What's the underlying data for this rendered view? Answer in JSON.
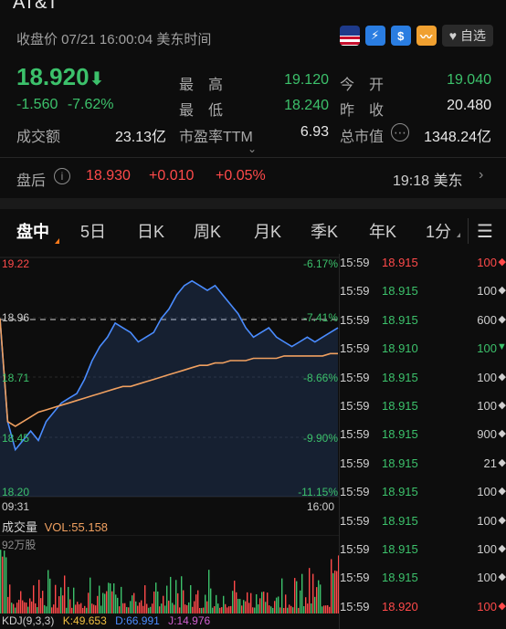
{
  "header": {
    "title": "AT&T",
    "status": "收盘价 07/21 16:00:04 美东时间",
    "watch_label": "自选"
  },
  "quote": {
    "price": "18.920",
    "arrow": "⬇",
    "change": "-1.560",
    "change_pct": "-7.62%",
    "high_label": "最　高",
    "high": "19.120",
    "open_label": "今　开",
    "open": "19.040",
    "low_label": "最　低",
    "low": "18.240",
    "prev_label": "昨　收",
    "prev": "20.480",
    "turnover_label": "成交额",
    "turnover": "23.13亿",
    "pe_label": "市盈率TTM",
    "pe": "6.93",
    "mcap_label": "总市值",
    "mcap": "1348.24亿"
  },
  "after_hours": {
    "label": "盘后",
    "price": "18.930",
    "change": "+0.010",
    "change_pct": "+0.05%",
    "time": "19:18 美东"
  },
  "tabs": [
    "盘中",
    "5日",
    "日K",
    "周K",
    "月K",
    "季K",
    "年K",
    "1分"
  ],
  "chart": {
    "y_labels": [
      "19.22",
      "18.96",
      "18.71",
      "18.45",
      "18.20"
    ],
    "pct_labels": [
      "-6.17%",
      "-7.41%",
      "-8.66%",
      "-9.90%",
      "-11.15%"
    ],
    "x_start": "09:31",
    "x_end": "16:00",
    "volume_title": "成交量",
    "volume_value": "VOL:55.158",
    "volume_scale": "92万股",
    "kdj_label": "KDJ(9,3,3)",
    "kdj_k": "K:49.653",
    "kdj_d": "D:66.991",
    "kdj_j": "J:14.976",
    "price_line": [
      18.96,
      18.52,
      18.4,
      18.44,
      18.48,
      18.44,
      18.52,
      18.56,
      18.6,
      18.62,
      18.64,
      18.7,
      18.78,
      18.84,
      18.88,
      18.94,
      18.92,
      18.9,
      18.86,
      18.88,
      18.9,
      18.96,
      19.0,
      19.06,
      19.1,
      19.12,
      19.1,
      19.08,
      19.1,
      19.06,
      19.02,
      18.98,
      18.92,
      18.88,
      18.9,
      18.92,
      18.88,
      18.86,
      18.84,
      18.86,
      18.88,
      18.86,
      18.88,
      18.9,
      18.92
    ],
    "avg_line": [
      18.96,
      18.52,
      18.5,
      18.52,
      18.54,
      18.56,
      18.57,
      18.58,
      18.59,
      18.6,
      18.61,
      18.62,
      18.63,
      18.64,
      18.65,
      18.66,
      18.67,
      18.67,
      18.68,
      18.69,
      18.7,
      18.71,
      18.72,
      18.73,
      18.74,
      18.75,
      18.76,
      18.76,
      18.77,
      18.77,
      18.78,
      18.78,
      18.78,
      18.79,
      18.79,
      18.79,
      18.79,
      18.8,
      18.8,
      18.8,
      18.8,
      18.8,
      18.8,
      18.81,
      18.81
    ],
    "y_min": 18.2,
    "y_max": 19.22
  },
  "ticks": [
    {
      "time": "15:59",
      "price": "18.915",
      "vol": "100",
      "dir": "◆",
      "color": "#ff4a4a"
    },
    {
      "time": "15:59",
      "price": "18.915",
      "vol": "100",
      "dir": "◆",
      "color": "#cfcfcf"
    },
    {
      "time": "15:59",
      "price": "18.915",
      "vol": "600",
      "dir": "◆",
      "color": "#cfcfcf"
    },
    {
      "time": "15:59",
      "price": "18.910",
      "vol": "100",
      "dir": "▼",
      "color": "#3cc16b"
    },
    {
      "time": "15:59",
      "price": "18.915",
      "vol": "100",
      "dir": "◆",
      "color": "#cfcfcf"
    },
    {
      "time": "15:59",
      "price": "18.915",
      "vol": "100",
      "dir": "◆",
      "color": "#cfcfcf"
    },
    {
      "time": "15:59",
      "price": "18.915",
      "vol": "900",
      "dir": "◆",
      "color": "#cfcfcf"
    },
    {
      "time": "15:59",
      "price": "18.915",
      "vol": "21",
      "dir": "◆",
      "color": "#cfcfcf"
    },
    {
      "time": "15:59",
      "price": "18.915",
      "vol": "100",
      "dir": "◆",
      "color": "#cfcfcf"
    },
    {
      "time": "15:59",
      "price": "18.915",
      "vol": "100",
      "dir": "◆",
      "color": "#cfcfcf"
    },
    {
      "time": "15:59",
      "price": "18.915",
      "vol": "100",
      "dir": "◆",
      "color": "#cfcfcf"
    },
    {
      "time": "15:59",
      "price": "18.915",
      "vol": "100",
      "dir": "◆",
      "color": "#cfcfcf"
    },
    {
      "time": "15:59",
      "price": "18.920",
      "vol": "100",
      "dir": "◆",
      "color": "#ff4a4a"
    }
  ],
  "colors": {
    "up": "#ff4a4a",
    "down": "#3cc16b",
    "line": "#4a8cff",
    "avg": "#f0a060",
    "accent": "#ff7a1a"
  }
}
